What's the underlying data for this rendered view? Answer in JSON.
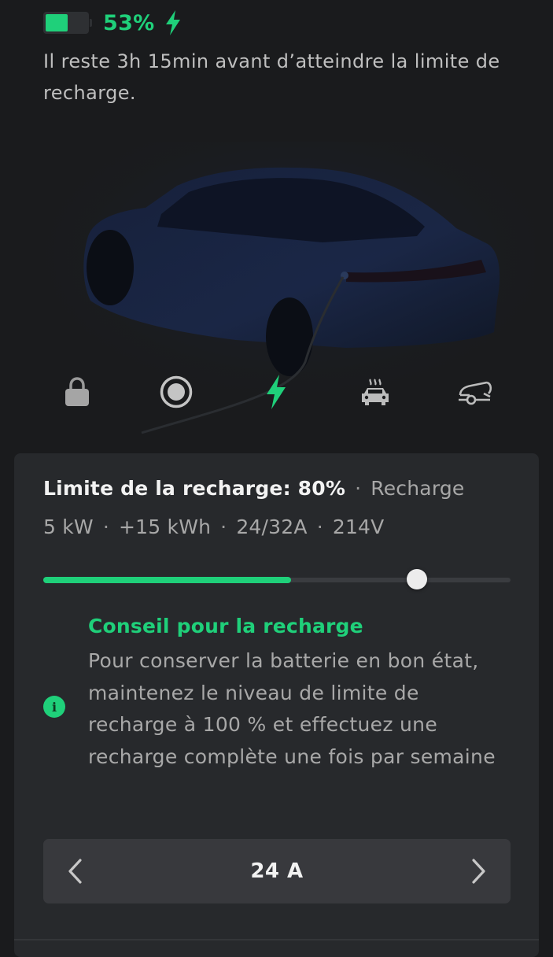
{
  "status": {
    "battery_level": 0.53,
    "battery_percent": "53%",
    "charging": true,
    "remaining_text": "Il reste 3h 15min avant d’atteindre la limite de recharge."
  },
  "controls": [
    {
      "name": "lock-icon",
      "icon": "lock"
    },
    {
      "name": "sentry-icon",
      "icon": "sentry-record"
    },
    {
      "name": "charge-icon",
      "icon": "bolt",
      "active": true
    },
    {
      "name": "climate-icon",
      "icon": "car-heat"
    },
    {
      "name": "trunk-icon",
      "icon": "car-trunk"
    }
  ],
  "charge_panel": {
    "limit_label": "Limite de la recharge: 80%",
    "state_label": "Recharge",
    "stats": {
      "power": "5 kW",
      "energy_added": "+15 kWh",
      "current": "24/32A",
      "voltage": "214V"
    },
    "slider": {
      "current_level": 0.53,
      "limit_level": 0.8
    },
    "tip": {
      "title": "Conseil pour la recharge",
      "body": "Pour conserver la batterie en bon état, maintenez le niveau de limite de recharge à 100 % et effectuez une recharge complète une fois par semaine"
    },
    "amps": {
      "value": "24 A"
    }
  },
  "colors": {
    "accent": "#1fd07a",
    "background": "#1a1b1d",
    "panel": "#27292c",
    "muted_text": "#a8a8a8"
  }
}
